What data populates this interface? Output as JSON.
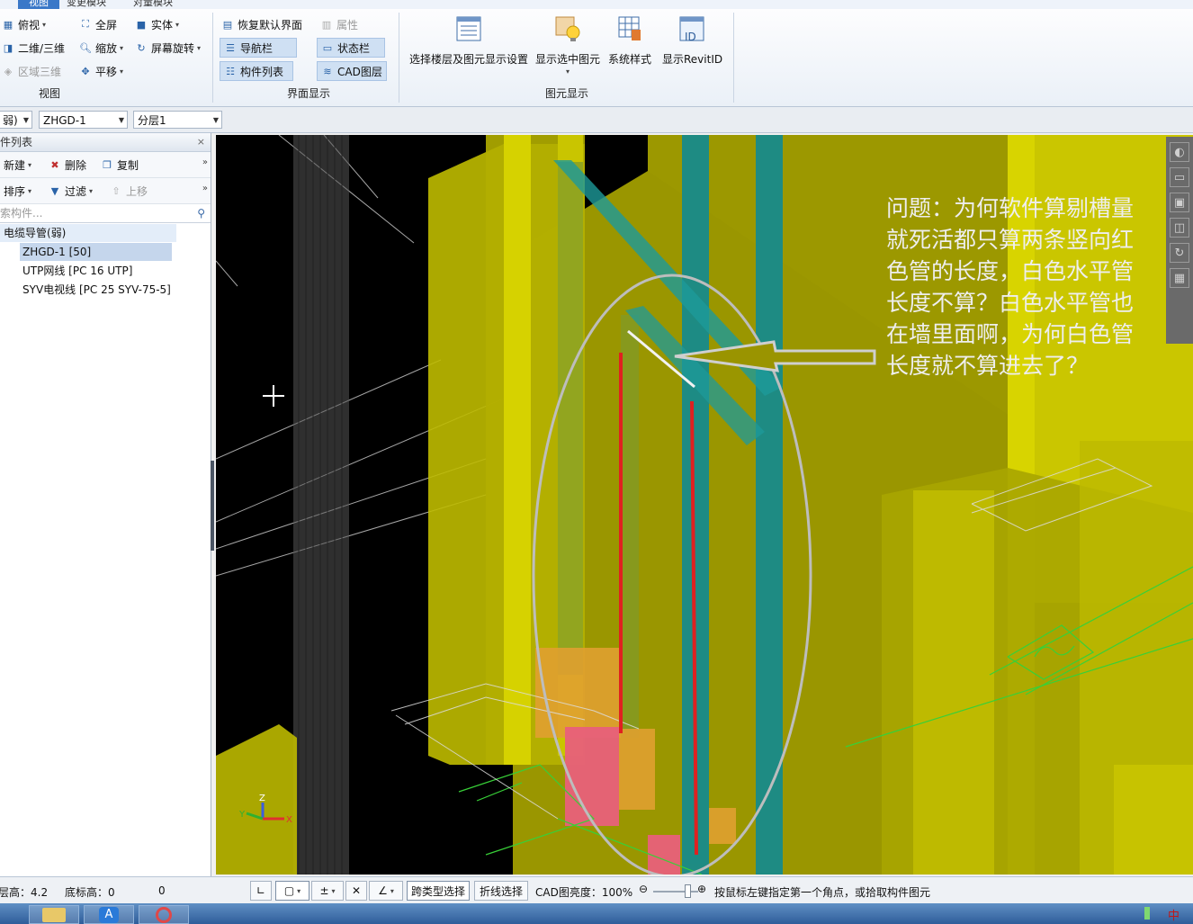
{
  "tabs": {
    "view": "视图",
    "change_module": "变更模块",
    "quantity_module": "对量模块"
  },
  "ribbon": {
    "view_group": {
      "title": "视图",
      "top_view": "俯视",
      "full_screen": "全屏",
      "solid": "实体",
      "two_three_d": "二维/三维",
      "zoom": "缩放",
      "screen_rotate": "屏幕旋转",
      "region_3d": "区域三维",
      "pan": "平移"
    },
    "ui_group": {
      "title": "界面显示",
      "restore_default": "恢复默认界面",
      "properties": "属性",
      "nav_bar": "导航栏",
      "status_bar": "状态栏",
      "component_list": "构件列表",
      "cad_layer": "CAD图层"
    },
    "element_group": {
      "title": "图元显示",
      "select_floor": "选择楼层及图元显示设置",
      "show_selected": "显示选中图元",
      "system_style": "系统样式",
      "show_revit_id": "显示RevitID",
      "revit_icon_text": "ID"
    }
  },
  "selector": {
    "type": "弱)",
    "component": "ZHGD-1",
    "layer": "分层1"
  },
  "left_panel": {
    "title": "件列表",
    "new": "新建",
    "delete": "删除",
    "copy": "复制",
    "sort": "排序",
    "filter": "过滤",
    "move_up": "上移",
    "search_placeholder": "索构件...",
    "tree": [
      {
        "label": "电缆导管(弱)",
        "level": 0
      },
      {
        "label": "ZHGD-1 [50]",
        "level": 1,
        "selected": true
      },
      {
        "label": "UTP网线 [PC 16 UTP]",
        "level": 1
      },
      {
        "label": "SYV电视线 [PC 25 SYV-75-5]",
        "level": 1
      }
    ]
  },
  "viewport": {
    "annotation": "问题：为何软件算剔槽量就死活都只算两条竖向红色管的长度，白色水平管长度不算？白色水平管也在墙里面啊，为何白色管长度就不算进去了？",
    "axis_x": "X",
    "axis_y": "Y",
    "axis_z": "Z"
  },
  "status": {
    "floor_height": "层高：4.2",
    "base_elevation": "底标高：0",
    "value": "0",
    "cross_type_select": "跨类型选择",
    "polyline_select": "折线选择",
    "cad_brightness": "CAD图亮度：100%",
    "hint": "按鼠标左键指定第一个角点，或拾取构件图元"
  },
  "taskbar": {
    "ime": "中"
  },
  "colors": {
    "wall": "#c8c400",
    "pipe": "#1b8f8f",
    "red_pipe": "#e02020",
    "accent": "#3a78c8"
  }
}
